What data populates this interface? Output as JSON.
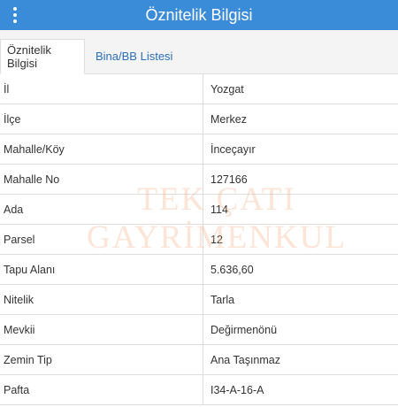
{
  "header": {
    "title": "Öznitelik Bilgisi",
    "menu_icon": "kebab-vertical-icon",
    "color": "#3a8bd8"
  },
  "tabs": [
    {
      "label": "Öznitelik Bilgisi",
      "active": true
    },
    {
      "label": "Bina/BB Listesi",
      "active": false
    }
  ],
  "rows": [
    {
      "label": "İl",
      "value": "Yozgat"
    },
    {
      "label": "İlçe",
      "value": "Merkez"
    },
    {
      "label": "Mahalle/Köy",
      "value": "İnceçayır"
    },
    {
      "label": "Mahalle No",
      "value": "127166"
    },
    {
      "label": "Ada",
      "value": "114"
    },
    {
      "label": "Parsel",
      "value": "12"
    },
    {
      "label": "Tapu Alanı",
      "value": "5.636,60"
    },
    {
      "label": "Nitelik",
      "value": "Tarla"
    },
    {
      "label": "Mevkii",
      "value": "Değirmenönü"
    },
    {
      "label": "Zemin Tip",
      "value": "Ana Taşınmaz"
    },
    {
      "label": "Pafta",
      "value": "I34-A-16-A"
    }
  ],
  "watermark": {
    "line1": "TEK ÇATI",
    "line2": "GAYRİMENKUL"
  }
}
